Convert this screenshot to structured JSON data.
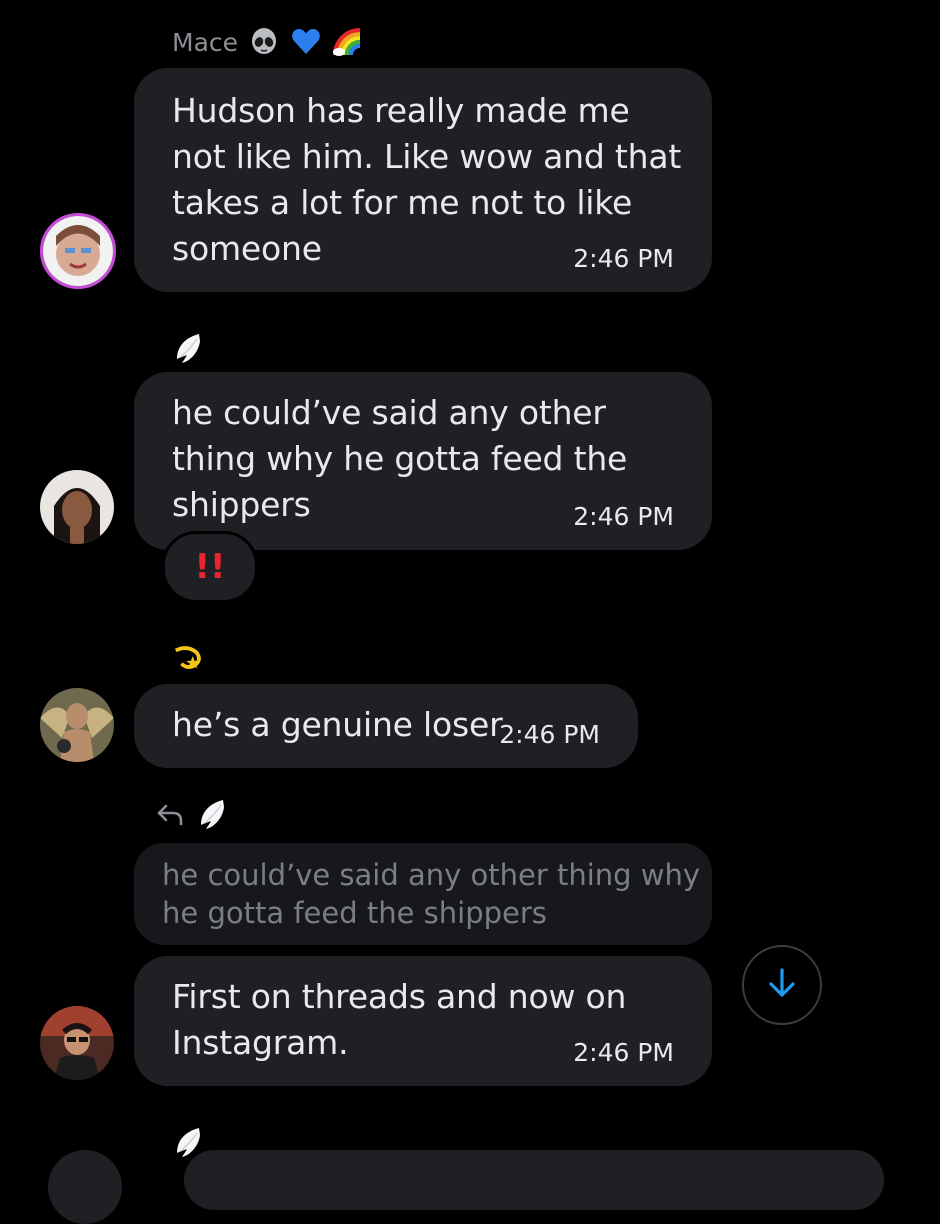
{
  "messages": [
    {
      "sender_name": "Mace",
      "name_icons": [
        "alien-icon",
        "blue-heart-icon",
        "rainbow-icon"
      ],
      "text_lines": [
        "Hudson has really made me",
        "not like him. Like wow and that",
        "takes a lot for me not to like",
        "someone"
      ],
      "time": "2:46 PM"
    },
    {
      "name_icons": [
        "angel-wing-icon"
      ],
      "text_lines": [
        "he could’ve said any other",
        "thing why he gotta feed the",
        "shippers"
      ],
      "time": "2:46 PM",
      "reaction": "!!"
    },
    {
      "name_icons": [
        "dizzy-star-icon"
      ],
      "text_lines": [
        "he’s a genuine loser"
      ],
      "time": "2:46 PM"
    },
    {
      "name_icons": [
        "reply-arrow-icon",
        "angel-wing-icon"
      ],
      "reply_to_lines": [
        "he could’ve said any other thing why",
        "he gotta feed the shippers"
      ],
      "text_lines": [
        "First on threads and now on",
        "Instagram."
      ],
      "time": "2:46 PM"
    },
    {
      "name_icons": [
        "angel-wing-icon"
      ]
    }
  ],
  "scroll_button": {
    "icon": "arrow-down-icon",
    "color": "#1d9bf0"
  },
  "colors": {
    "background": "#000000",
    "bubble": "#1f2023",
    "reaction_mark": "#e8262c",
    "accent": "#1d9bf0"
  }
}
